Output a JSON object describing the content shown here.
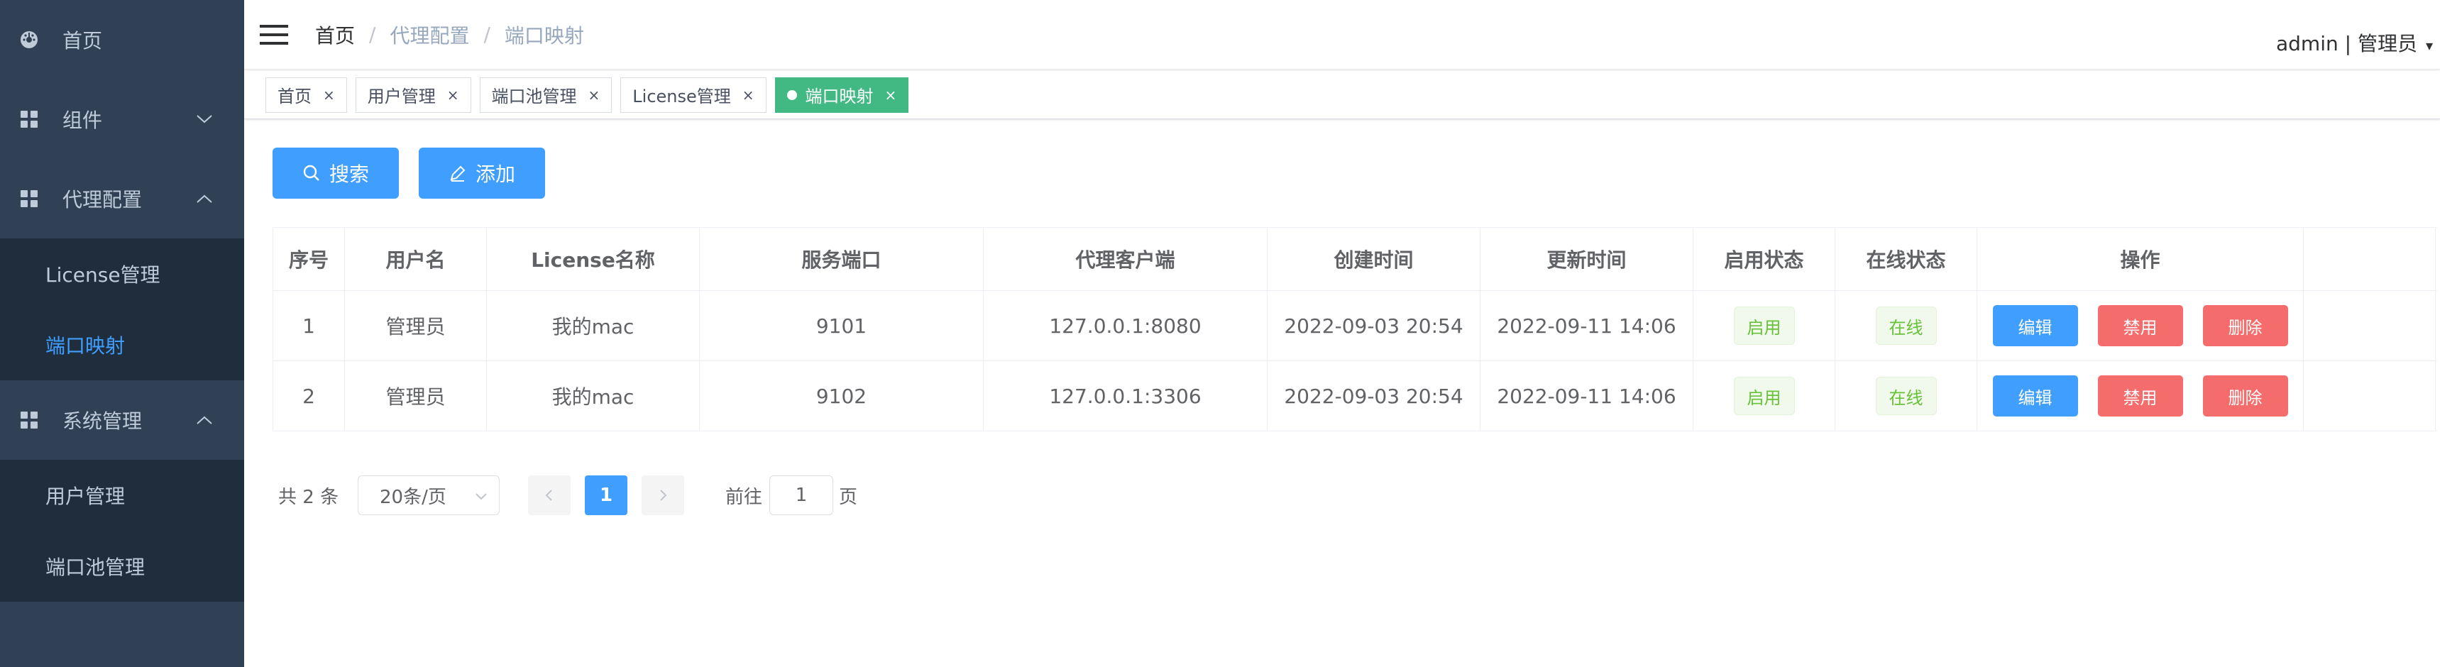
{
  "sidebar": {
    "items": [
      {
        "label": "首页",
        "icon": "dashboard-icon"
      },
      {
        "label": "组件",
        "icon": "component-icon"
      },
      {
        "label": "代理配置",
        "icon": "component-icon",
        "children": [
          {
            "label": "License管理",
            "active": false
          },
          {
            "label": "端口映射",
            "active": true
          }
        ]
      },
      {
        "label": "系统管理",
        "icon": "component-icon",
        "children": [
          {
            "label": "用户管理"
          },
          {
            "label": "端口池管理"
          }
        ]
      }
    ]
  },
  "navbar": {
    "breadcrumb": [
      "首页",
      "代理配置",
      "端口映射"
    ],
    "separator": "/",
    "user": "admin | 管理员"
  },
  "tags": [
    {
      "label": "首页",
      "active": false
    },
    {
      "label": "用户管理",
      "active": false
    },
    {
      "label": "端口池管理",
      "active": false
    },
    {
      "label": "License管理",
      "active": false
    },
    {
      "label": "端口映射",
      "active": true
    }
  ],
  "toolbar": {
    "search_label": "搜索",
    "add_label": "添加"
  },
  "table": {
    "columns": [
      "序号",
      "用户名",
      "License名称",
      "服务端口",
      "代理客户端",
      "创建时间",
      "更新时间",
      "启用状态",
      "在线状态",
      "操作"
    ],
    "rows": [
      {
        "index": "1",
        "user": "管理员",
        "license": "我的mac",
        "port": "9101",
        "client": "127.0.0.1:8080",
        "created": "2022-09-03 20:54",
        "updated": "2022-09-11 14:06",
        "enabled": "启用",
        "online": "在线"
      },
      {
        "index": "2",
        "user": "管理员",
        "license": "我的mac",
        "port": "9102",
        "client": "127.0.0.1:3306",
        "created": "2022-09-03 20:54",
        "updated": "2022-09-11 14:06",
        "enabled": "启用",
        "online": "在线"
      }
    ],
    "actions": {
      "edit": "编辑",
      "disable": "禁用",
      "delete": "删除"
    }
  },
  "pagination": {
    "total_text": "共 2 条",
    "page_size": "20条/页",
    "current_page": "1",
    "goto_label": "前往",
    "goto_value": "1",
    "page_unit": "页"
  },
  "colors": {
    "sidebar_bg": "#304156",
    "sidebar_sub_bg": "#1f2d3d",
    "primary": "#409eff",
    "danger": "#f56c6c",
    "success_tag": "#42b983"
  }
}
